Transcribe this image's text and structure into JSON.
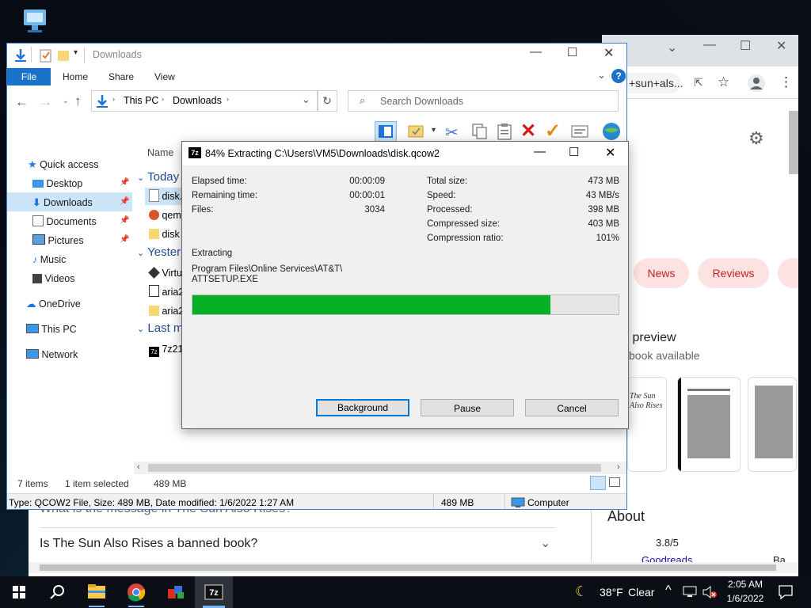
{
  "chrome": {
    "address_text": "+sun+als...",
    "chips": [
      "News",
      "Reviews"
    ],
    "book_preview_title": "k preview",
    "book_preview_subtitle": "book available",
    "book_title_text": "The Sun Also Rises",
    "faq_partial": "What is the message in The Sun Also Rises?",
    "faq_item": "Is The Sun Also Rises a banned book?",
    "about_title": "About",
    "rating": "3.8/5",
    "rating_source": "Goodreads",
    "ba_text": "Ba"
  },
  "explorer": {
    "title": "Downloads",
    "ribbon_tabs": [
      "File",
      "Home",
      "Share",
      "View"
    ],
    "breadcrumb": [
      "This PC",
      "Downloads"
    ],
    "search_placeholder": "Search Downloads",
    "column_name": "Name",
    "nav": {
      "quick_access": "Quick access",
      "desktop": "Desktop",
      "downloads": "Downloads",
      "documents": "Documents",
      "pictures": "Pictures",
      "music": "Music",
      "videos": "Videos",
      "onedrive": "OneDrive",
      "this_pc": "This PC",
      "network": "Network"
    },
    "groups": {
      "today": "Today",
      "yesterday": "Yester",
      "last": "Last m"
    },
    "files": {
      "f1": "disk.",
      "f2": "qem",
      "f3": "disk",
      "f4": "Virtu",
      "f5": "aria2",
      "f6": "aria2",
      "f7": "7z21"
    },
    "status": {
      "items": "7 items",
      "selected": "1 item selected",
      "size": "489 MB"
    },
    "details_bar": {
      "type_info": "Type: QCOW2 File, Size: 489 MB, Date modified: 1/6/2022 1:27 AM",
      "size": "489 MB",
      "location": "Computer"
    }
  },
  "dialog": {
    "title": "84% Extracting C:\\Users\\VM5\\Downloads\\disk.qcow2",
    "progress_percent": 84,
    "left_stats": [
      {
        "label": "Elapsed time:",
        "value": "00:00:09"
      },
      {
        "label": "Remaining time:",
        "value": "00:00:01"
      },
      {
        "label": "Files:",
        "value": "3034"
      }
    ],
    "right_stats": [
      {
        "label": "Total size:",
        "value": "473 MB"
      },
      {
        "label": "Speed:",
        "value": "43 MB/s"
      },
      {
        "label": "Processed:",
        "value": "398 MB"
      },
      {
        "label": "Compressed size:",
        "value": "403 MB"
      },
      {
        "label": "Compression ratio:",
        "value": "101%"
      }
    ],
    "extracting_label": "Extracting",
    "path_line1": "Program Files\\Online Services\\AT&T\\",
    "path_line2": "ATTSETUP.EXE",
    "buttons": {
      "background": "Background",
      "pause": "Pause",
      "cancel": "Cancel"
    }
  },
  "taskbar": {
    "weather_temp": "38°F",
    "weather_desc": "Clear",
    "time": "2:05 AM",
    "date": "1/6/2022"
  }
}
